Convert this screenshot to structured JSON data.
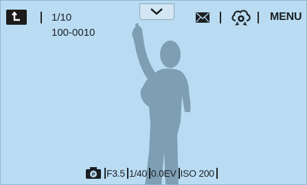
{
  "playback": {
    "counter": "1/10",
    "folder_file": "100-0010"
  },
  "toolbar": {
    "back_icon": "playback-back-icon",
    "expand_icon": "chevron-down-icon",
    "mail_icon": "mail-icon",
    "share_icon": "cloud-share-icon",
    "menu_label": "MENU"
  },
  "info": {
    "mode_icon": "camera-program-mode-icon",
    "aperture": "F3.5",
    "shutter": "1/40",
    "exposure": "0.0EV",
    "iso": "ISO 200"
  },
  "colors": {
    "background": "#b9dcf3",
    "silhouette": "#7e9eb3",
    "text": "#1b1f22"
  }
}
